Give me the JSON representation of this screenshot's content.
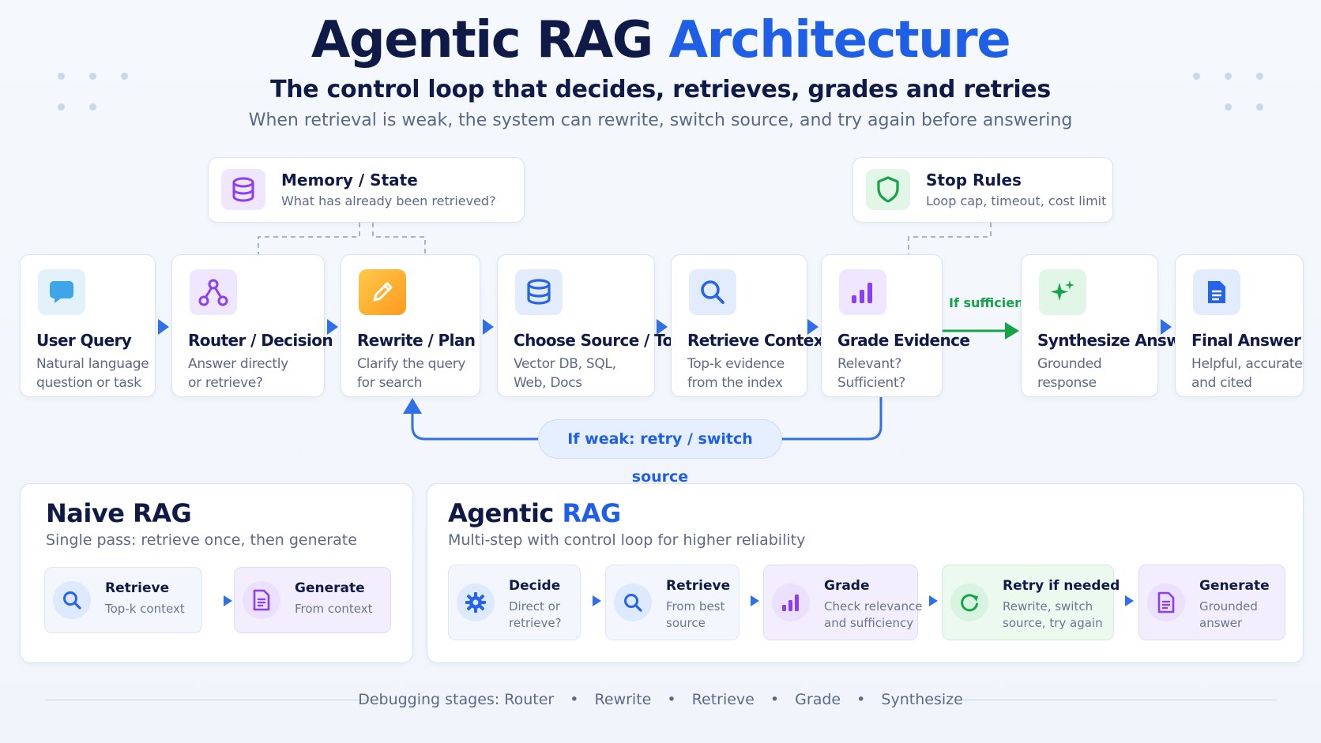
{
  "header": {
    "title_main": "Agentic RAG",
    "title_accent": "Architecture",
    "subtitle": "The control loop that decides, retrieves, grades and retries",
    "lede": "When retrieval is weak, the system can rewrite, switch source, and try again before answering"
  },
  "side_cards": {
    "memory": {
      "title": "Memory / State",
      "desc": "What has already been retrieved?",
      "icon": "database-icon"
    },
    "stop": {
      "title": "Stop Rules",
      "desc": "Loop cap, timeout, cost limit",
      "icon": "shield-icon"
    }
  },
  "pipeline": [
    {
      "title": "User Query",
      "line1": "Natural language",
      "line2": "question or task",
      "icon": "chat-bubble-icon"
    },
    {
      "title": "Router / Decision",
      "line1": "Answer directly",
      "line2": "or retrieve?",
      "icon": "network-icon"
    },
    {
      "title": "Rewrite / Plan",
      "line1": "Clarify the query",
      "line2": "for search",
      "icon": "pencil-icon"
    },
    {
      "title": "Choose Source / Tool",
      "line1": "Vector DB, SQL,",
      "line2": "Web, Docs",
      "icon": "database-icon"
    },
    {
      "title": "Retrieve Context",
      "line1": "Top-k evidence",
      "line2": "from the index",
      "icon": "search-icon"
    },
    {
      "title": "Grade Evidence",
      "line1": "Relevant?",
      "line2": "Sufficient?",
      "icon": "bar-chart-icon"
    },
    {
      "title": "Synthesize Answer",
      "line1": "Grounded",
      "line2": "response",
      "icon": "sparkle-icon"
    },
    {
      "title": "Final Answer",
      "line1": "Helpful, accurate",
      "line2": "and cited",
      "icon": "document-icon"
    }
  ],
  "flow_labels": {
    "if_sufficient": "If sufficient",
    "if_weak": "If weak: retry / switch source"
  },
  "naive": {
    "title": "Naive RAG",
    "subtitle": "Single pass: retrieve once, then generate",
    "steps": [
      {
        "title": "Retrieve",
        "line1": "Top-k context",
        "icon": "search-icon"
      },
      {
        "title": "Generate",
        "line1": "From context",
        "icon": "document-icon"
      }
    ]
  },
  "agentic": {
    "title_main": "Agentic",
    "title_accent": "RAG",
    "subtitle": "Multi-step with control loop for higher reliability",
    "steps": [
      {
        "title": "Decide",
        "line1": "Direct or",
        "line2": "retrieve?",
        "icon": "gear-icon"
      },
      {
        "title": "Retrieve",
        "line1": "From best",
        "line2": "source",
        "icon": "search-icon"
      },
      {
        "title": "Grade",
        "line1": "Check relevance",
        "line2": "and sufficiency",
        "icon": "bar-chart-icon"
      },
      {
        "title": "Retry if needed",
        "line1": "Rewrite, switch",
        "line2": "source, try again",
        "icon": "refresh-icon"
      },
      {
        "title": "Generate",
        "line1": "Grounded",
        "line2": "answer",
        "icon": "document-icon"
      }
    ]
  },
  "footer": {
    "label": "Debugging stages:",
    "stages": [
      "Router",
      "Rewrite",
      "Retrieve",
      "Grade",
      "Synthesize"
    ]
  },
  "colors": {
    "accent": "#1f5fe8",
    "success": "#16a34a",
    "ink": "#0f1a46"
  }
}
